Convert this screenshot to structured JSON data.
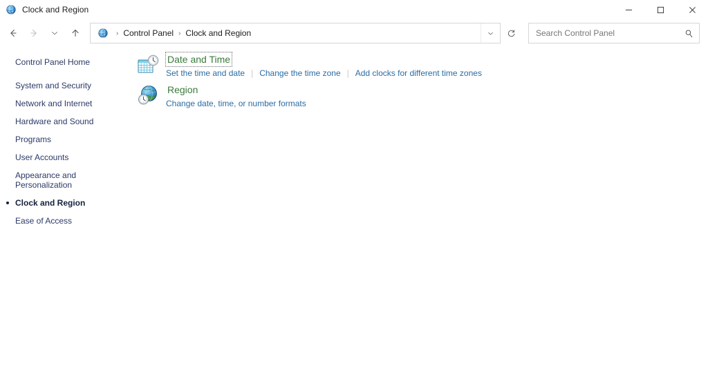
{
  "window": {
    "title": "Clock and Region",
    "app_icon": "control-panel-globe-icon",
    "controls": {
      "minimize": "–",
      "maximize": "□",
      "close": "✕"
    }
  },
  "navbar": {
    "back": "back-arrow",
    "forward": "forward-arrow",
    "recent": "chevron-down",
    "up": "up-arrow",
    "address": {
      "icon": "control-panel-globe-icon",
      "separator": "›",
      "crumbs": [
        "Control Panel",
        "Clock and Region"
      ],
      "dropdown": "chevron-down",
      "refresh": "refresh-icon"
    },
    "search": {
      "placeholder": "Search Control Panel",
      "value": "",
      "icon": "search-icon"
    }
  },
  "sidebar": {
    "home": "Control Panel Home",
    "items": [
      {
        "label": "System and Security",
        "current": false
      },
      {
        "label": "Network and Internet",
        "current": false
      },
      {
        "label": "Hardware and Sound",
        "current": false
      },
      {
        "label": "Programs",
        "current": false
      },
      {
        "label": "User Accounts",
        "current": false
      },
      {
        "label": "Appearance and Personalization",
        "current": false
      },
      {
        "label": "Clock and Region",
        "current": true
      },
      {
        "label": "Ease of Access",
        "current": false
      }
    ]
  },
  "content": {
    "categories": [
      {
        "title": "Date and Time",
        "icon": "date-and-time-icon",
        "focused": true,
        "tasks": [
          "Set the time and date",
          "Change the time zone",
          "Add clocks for different time zones"
        ]
      },
      {
        "title": "Region",
        "icon": "region-globe-clock-icon",
        "focused": false,
        "tasks": [
          "Change date, time, or number formats"
        ]
      }
    ]
  },
  "colors": {
    "category_title": "#3a7a3a",
    "task_link": "#2b6ca3",
    "sidebar_link": "#2b3a67",
    "sidebar_current": "#14213d",
    "border": "#d6d6d6"
  }
}
